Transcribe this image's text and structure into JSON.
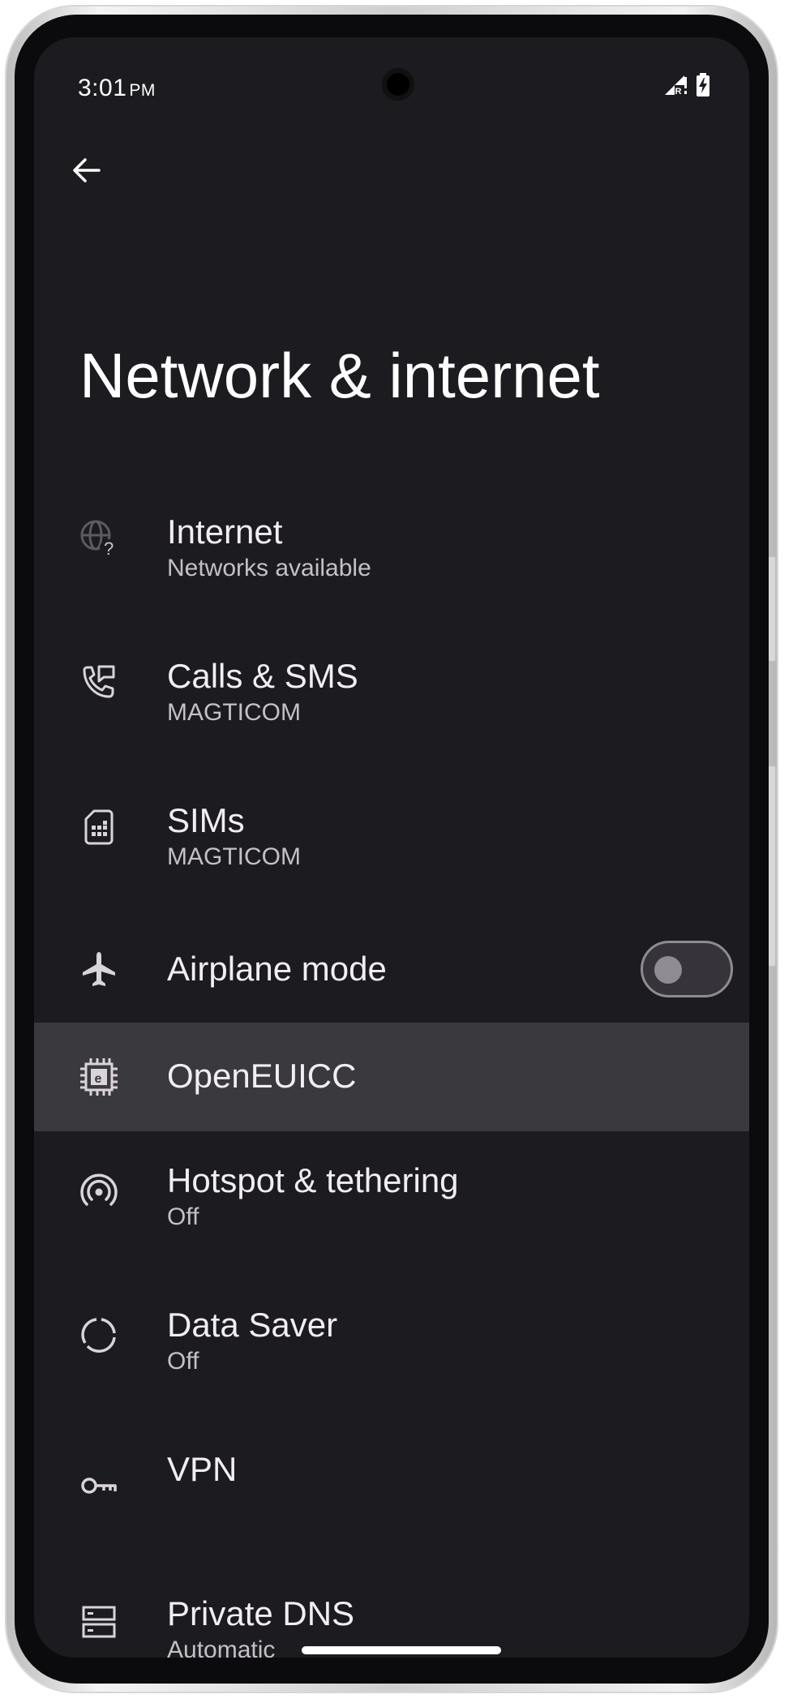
{
  "status_bar": {
    "time": "3:01",
    "ampm": "PM",
    "signal_icon": "signal-roaming-icon",
    "battery_icon": "battery-charging-icon"
  },
  "toolbar": {
    "back_icon": "arrow-back-icon"
  },
  "page": {
    "title": "Network & internet"
  },
  "items": [
    {
      "icon": "globe-question-icon",
      "title": "Internet",
      "subtitle": "Networks available"
    },
    {
      "icon": "phone-message-icon",
      "title": "Calls & SMS",
      "subtitle": "MAGTICOM"
    },
    {
      "icon": "sim-card-icon",
      "title": "SIMs",
      "subtitle": "MAGTICOM"
    },
    {
      "icon": "airplane-icon",
      "title": "Airplane mode",
      "toggle": "off"
    },
    {
      "icon": "euicc-chip-icon",
      "title": "OpenEUICC",
      "highlighted": true
    },
    {
      "icon": "hotspot-icon",
      "title": "Hotspot & tethering",
      "subtitle": "Off"
    },
    {
      "icon": "data-saver-icon",
      "title": "Data Saver",
      "subtitle": "Off"
    },
    {
      "icon": "vpn-key-icon",
      "title": "VPN"
    },
    {
      "icon": "dns-icon",
      "title": "Private DNS",
      "subtitle": "Automatic"
    }
  ],
  "colors": {
    "background": "#1c1b20",
    "highlight": "#3a393e",
    "text_primary": "#f2edf2",
    "text_secondary": "#c4c0c6",
    "toggle_outline": "#8f8b92"
  }
}
